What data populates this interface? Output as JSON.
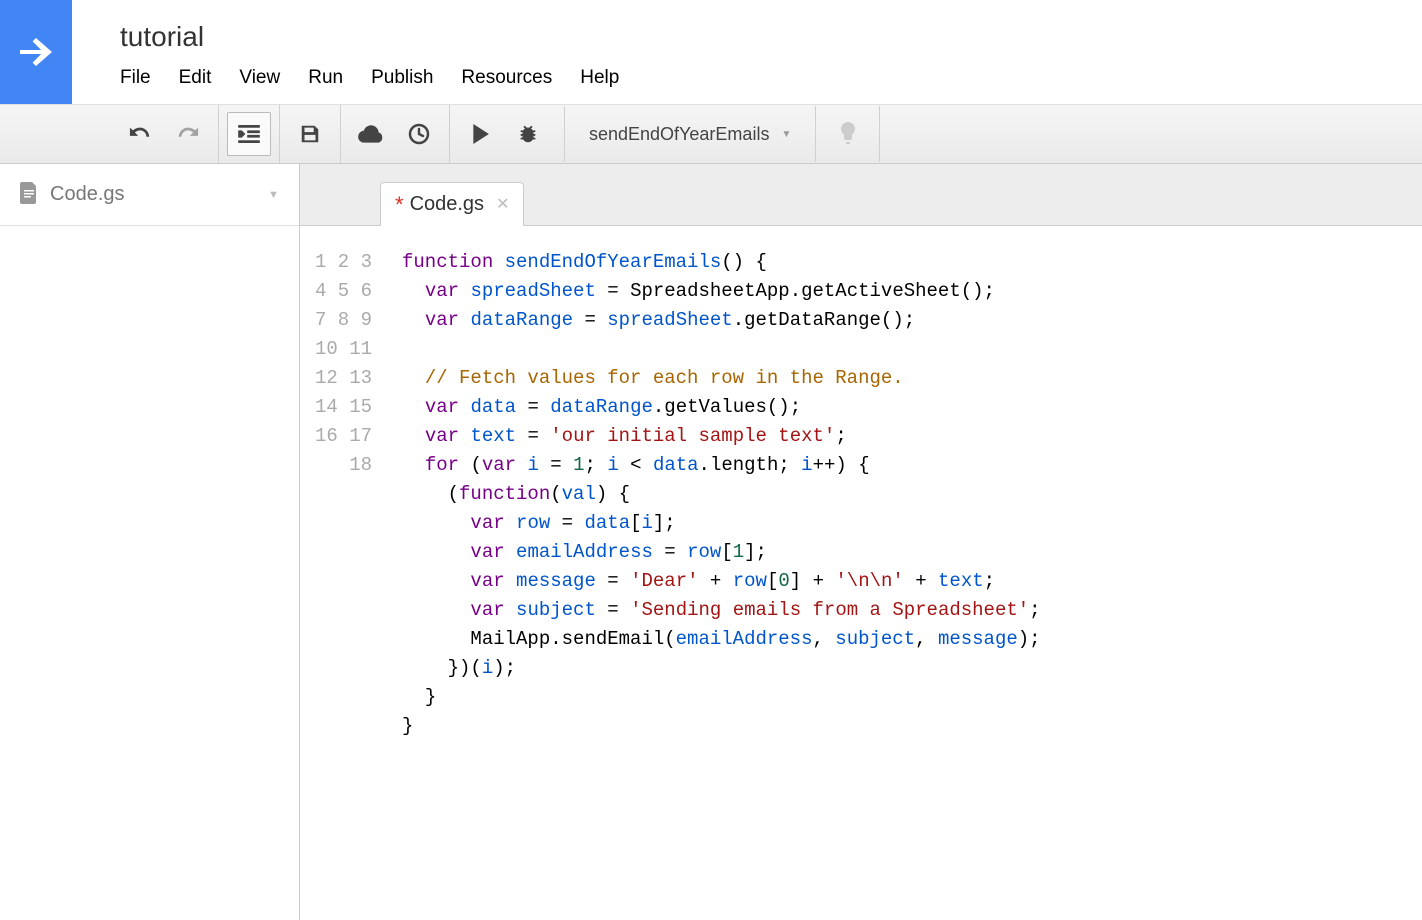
{
  "project_title": "tutorial",
  "menu": [
    "File",
    "Edit",
    "View",
    "Run",
    "Publish",
    "Resources",
    "Help"
  ],
  "toolbar": {
    "function_selected": "sendEndOfYearEmails"
  },
  "sidebar": {
    "files": [
      {
        "name": "Code.gs"
      }
    ]
  },
  "tabs": [
    {
      "label": "Code.gs",
      "dirty": true
    }
  ],
  "code": {
    "function_name": "sendEndOfYearEmails",
    "comment": "// Fetch values for each row in the Range.",
    "string_initial": "'our initial sample text'",
    "string_dear": "'Dear'",
    "string_nl": "'\\n\\n'",
    "string_subject": "'Sending emails from a Spreadsheet'",
    "lines": 18
  }
}
